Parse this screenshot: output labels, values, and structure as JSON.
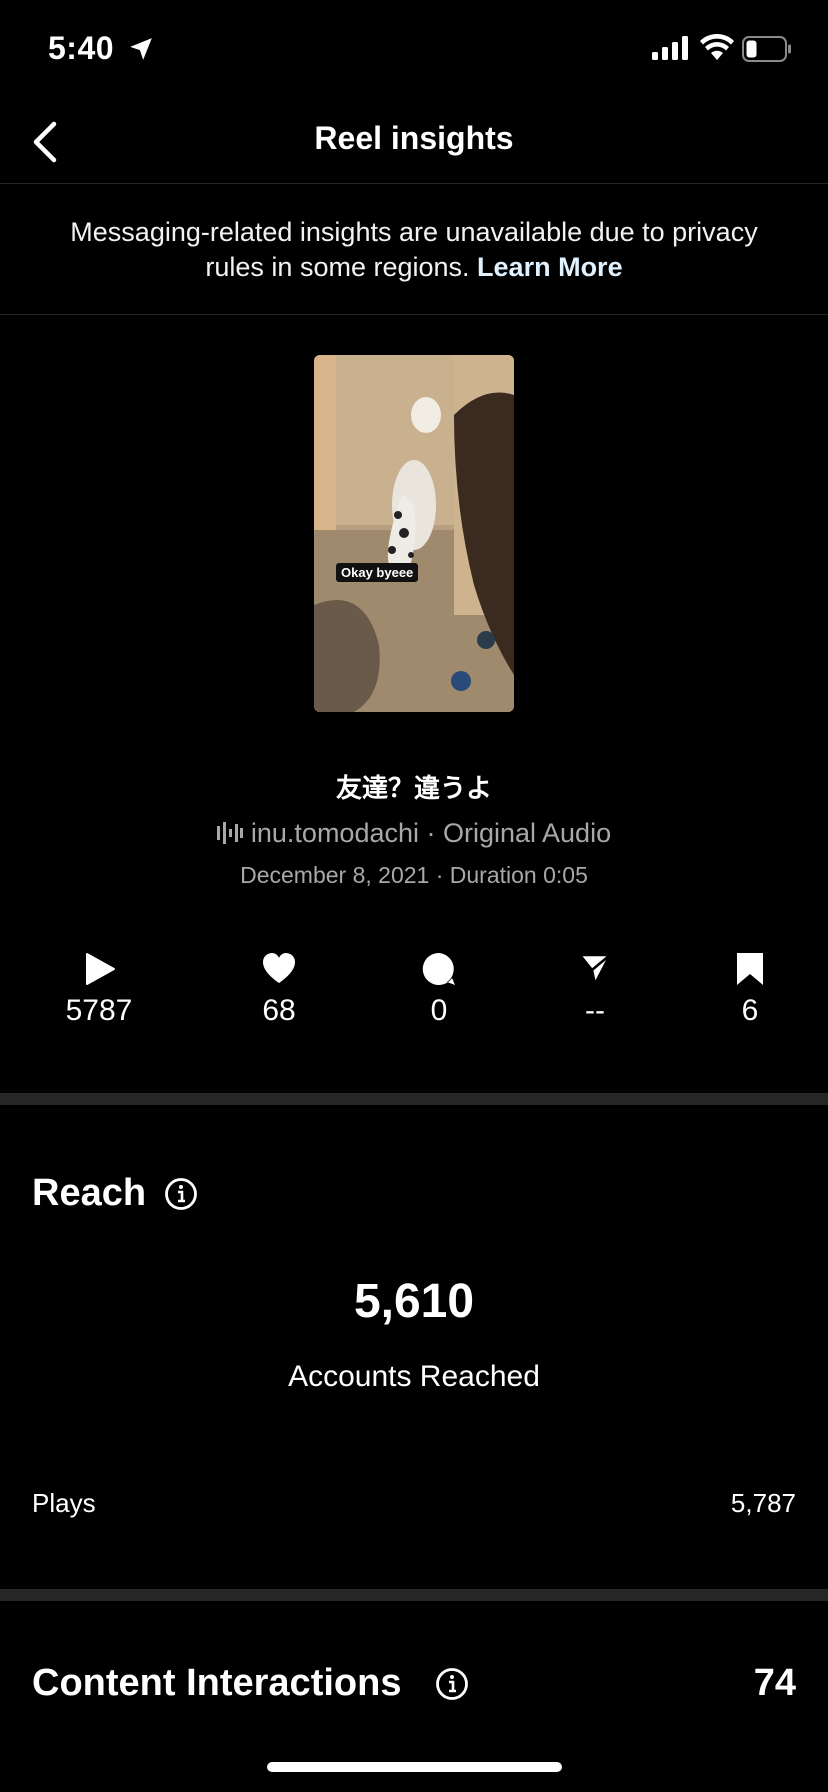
{
  "status_bar": {
    "time": "5:40"
  },
  "header": {
    "title": "Reel insights"
  },
  "notice": {
    "text": "Messaging-related insights are unavailable due to privacy rules in some regions.",
    "link": "Learn More"
  },
  "reel": {
    "thumbnail_caption": "Okay byeee",
    "title": "友達？違うよ",
    "audio": "inu.tomodachi · Original Audio",
    "meta": "December 8, 2021 · Duration 0:05"
  },
  "stats": {
    "plays": "5787",
    "likes": "68",
    "comments": "0",
    "shares": "--",
    "saves": "6"
  },
  "reach": {
    "title": "Reach",
    "accounts_reached": "5,610",
    "accounts_reached_label": "Accounts Reached",
    "plays_label": "Plays",
    "plays_value": "5,787"
  },
  "content_interactions": {
    "title": "Content Interactions",
    "value": "74"
  },
  "colors": {
    "background": "#000000",
    "divider": "#262626",
    "secondary_text": "#a8a8a8"
  }
}
